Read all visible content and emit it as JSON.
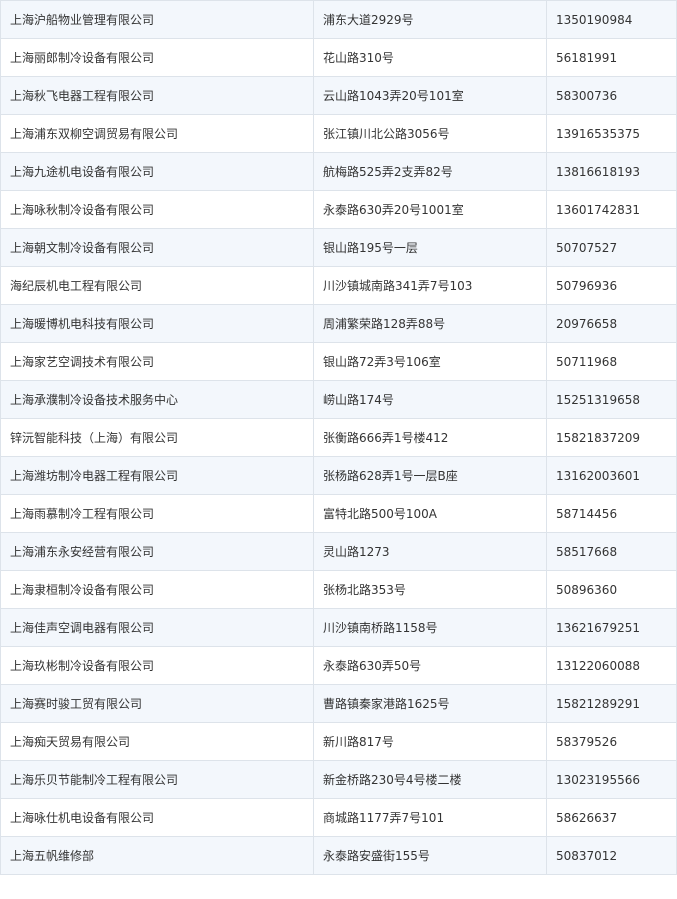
{
  "rows": [
    {
      "company": "上海沪船物业管理有限公司",
      "address": "浦东大道2929号",
      "phone": "1350190984"
    },
    {
      "company": "上海丽郎制冷设备有限公司",
      "address": "花山路310号",
      "phone": "56181991"
    },
    {
      "company": "上海秋飞电器工程有限公司",
      "address": "云山路1043弄20号101室",
      "phone": "58300736"
    },
    {
      "company": "上海浦东双柳空调贸易有限公司",
      "address": "张江镇川北公路3056号",
      "phone": "13916535375"
    },
    {
      "company": "上海九途机电设备有限公司",
      "address": "航梅路525弄2支弄82号",
      "phone": "13816618193"
    },
    {
      "company": "上海咏秋制冷设备有限公司",
      "address": "永泰路630弄20号1001室",
      "phone": "13601742831"
    },
    {
      "company": "上海朝文制冷设备有限公司",
      "address": "银山路195号一层",
      "phone": "50707527"
    },
    {
      "company": "海纪辰机电工程有限公司",
      "address": "川沙镇城南路341弄7号103",
      "phone": "50796936"
    },
    {
      "company": "上海暖博机电科技有限公司",
      "address": "周浦繁荣路128弄88号",
      "phone": "20976658"
    },
    {
      "company": "上海家艺空调技术有限公司",
      "address": "银山路72弄3号106室",
      "phone": "50711968"
    },
    {
      "company": "上海承濮制冷设备技术服务中心",
      "address": "崂山路174号",
      "phone": "15251319658"
    },
    {
      "company": "锌沅智能科技（上海）有限公司",
      "address": "张衡路666弄1号楼412",
      "phone": "15821837209"
    },
    {
      "company": "上海潍坊制冷电器工程有限公司",
      "address": "张杨路628弄1号一层B座",
      "phone": "13162003601"
    },
    {
      "company": "上海雨慕制冷工程有限公司",
      "address": "富特北路500号100A",
      "phone": "58714456"
    },
    {
      "company": "上海浦东永安经营有限公司",
      "address": "灵山路1273",
      "phone": "58517668"
    },
    {
      "company": "上海隶桓制冷设备有限公司",
      "address": "张杨北路353号",
      "phone": "50896360"
    },
    {
      "company": "上海佳声空调电器有限公司",
      "address": "川沙镇南桥路1158号",
      "phone": "13621679251"
    },
    {
      "company": "上海玖彬制冷设备有限公司",
      "address": "永泰路630弄50号",
      "phone": "13122060088"
    },
    {
      "company": "上海赛时骏工贸有限公司",
      "address": "曹路镇秦家港路1625号",
      "phone": "15821289291"
    },
    {
      "company": "上海痴天贸易有限公司",
      "address": "新川路817号",
      "phone": "58379526"
    },
    {
      "company": "上海乐贝节能制冷工程有限公司",
      "address": "新金桥路230号4号楼二楼",
      "phone": "13023195566"
    },
    {
      "company": "上海咏仕机电设备有限公司",
      "address": "商城路1177弄7号101",
      "phone": "58626637"
    },
    {
      "company": "上海五帆维修部",
      "address": "永泰路安盛街155号",
      "phone": "50837012"
    }
  ]
}
